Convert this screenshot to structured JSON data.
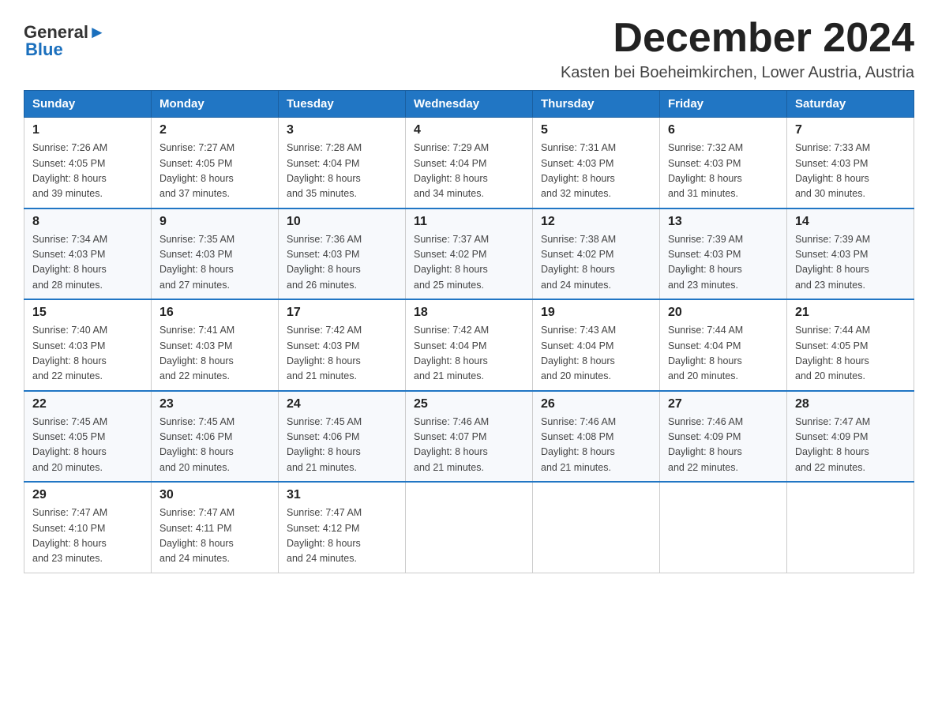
{
  "header": {
    "logo_text_general": "General",
    "logo_text_blue": "Blue",
    "month_title": "December 2024",
    "location": "Kasten bei Boeheimkirchen, Lower Austria, Austria"
  },
  "days_of_week": [
    "Sunday",
    "Monday",
    "Tuesday",
    "Wednesday",
    "Thursday",
    "Friday",
    "Saturday"
  ],
  "weeks": [
    [
      {
        "day": "1",
        "sunrise": "7:26 AM",
        "sunset": "4:05 PM",
        "daylight": "8 hours and 39 minutes."
      },
      {
        "day": "2",
        "sunrise": "7:27 AM",
        "sunset": "4:05 PM",
        "daylight": "8 hours and 37 minutes."
      },
      {
        "day": "3",
        "sunrise": "7:28 AM",
        "sunset": "4:04 PM",
        "daylight": "8 hours and 35 minutes."
      },
      {
        "day": "4",
        "sunrise": "7:29 AM",
        "sunset": "4:04 PM",
        "daylight": "8 hours and 34 minutes."
      },
      {
        "day": "5",
        "sunrise": "7:31 AM",
        "sunset": "4:03 PM",
        "daylight": "8 hours and 32 minutes."
      },
      {
        "day": "6",
        "sunrise": "7:32 AM",
        "sunset": "4:03 PM",
        "daylight": "8 hours and 31 minutes."
      },
      {
        "day": "7",
        "sunrise": "7:33 AM",
        "sunset": "4:03 PM",
        "daylight": "8 hours and 30 minutes."
      }
    ],
    [
      {
        "day": "8",
        "sunrise": "7:34 AM",
        "sunset": "4:03 PM",
        "daylight": "8 hours and 28 minutes."
      },
      {
        "day": "9",
        "sunrise": "7:35 AM",
        "sunset": "4:03 PM",
        "daylight": "8 hours and 27 minutes."
      },
      {
        "day": "10",
        "sunrise": "7:36 AM",
        "sunset": "4:03 PM",
        "daylight": "8 hours and 26 minutes."
      },
      {
        "day": "11",
        "sunrise": "7:37 AM",
        "sunset": "4:02 PM",
        "daylight": "8 hours and 25 minutes."
      },
      {
        "day": "12",
        "sunrise": "7:38 AM",
        "sunset": "4:02 PM",
        "daylight": "8 hours and 24 minutes."
      },
      {
        "day": "13",
        "sunrise": "7:39 AM",
        "sunset": "4:03 PM",
        "daylight": "8 hours and 23 minutes."
      },
      {
        "day": "14",
        "sunrise": "7:39 AM",
        "sunset": "4:03 PM",
        "daylight": "8 hours and 23 minutes."
      }
    ],
    [
      {
        "day": "15",
        "sunrise": "7:40 AM",
        "sunset": "4:03 PM",
        "daylight": "8 hours and 22 minutes."
      },
      {
        "day": "16",
        "sunrise": "7:41 AM",
        "sunset": "4:03 PM",
        "daylight": "8 hours and 22 minutes."
      },
      {
        "day": "17",
        "sunrise": "7:42 AM",
        "sunset": "4:03 PM",
        "daylight": "8 hours and 21 minutes."
      },
      {
        "day": "18",
        "sunrise": "7:42 AM",
        "sunset": "4:04 PM",
        "daylight": "8 hours and 21 minutes."
      },
      {
        "day": "19",
        "sunrise": "7:43 AM",
        "sunset": "4:04 PM",
        "daylight": "8 hours and 20 minutes."
      },
      {
        "day": "20",
        "sunrise": "7:44 AM",
        "sunset": "4:04 PM",
        "daylight": "8 hours and 20 minutes."
      },
      {
        "day": "21",
        "sunrise": "7:44 AM",
        "sunset": "4:05 PM",
        "daylight": "8 hours and 20 minutes."
      }
    ],
    [
      {
        "day": "22",
        "sunrise": "7:45 AM",
        "sunset": "4:05 PM",
        "daylight": "8 hours and 20 minutes."
      },
      {
        "day": "23",
        "sunrise": "7:45 AM",
        "sunset": "4:06 PM",
        "daylight": "8 hours and 20 minutes."
      },
      {
        "day": "24",
        "sunrise": "7:45 AM",
        "sunset": "4:06 PM",
        "daylight": "8 hours and 21 minutes."
      },
      {
        "day": "25",
        "sunrise": "7:46 AM",
        "sunset": "4:07 PM",
        "daylight": "8 hours and 21 minutes."
      },
      {
        "day": "26",
        "sunrise": "7:46 AM",
        "sunset": "4:08 PM",
        "daylight": "8 hours and 21 minutes."
      },
      {
        "day": "27",
        "sunrise": "7:46 AM",
        "sunset": "4:09 PM",
        "daylight": "8 hours and 22 minutes."
      },
      {
        "day": "28",
        "sunrise": "7:47 AM",
        "sunset": "4:09 PM",
        "daylight": "8 hours and 22 minutes."
      }
    ],
    [
      {
        "day": "29",
        "sunrise": "7:47 AM",
        "sunset": "4:10 PM",
        "daylight": "8 hours and 23 minutes."
      },
      {
        "day": "30",
        "sunrise": "7:47 AM",
        "sunset": "4:11 PM",
        "daylight": "8 hours and 24 minutes."
      },
      {
        "day": "31",
        "sunrise": "7:47 AM",
        "sunset": "4:12 PM",
        "daylight": "8 hours and 24 minutes."
      },
      null,
      null,
      null,
      null
    ]
  ],
  "labels": {
    "sunrise": "Sunrise:",
    "sunset": "Sunset:",
    "daylight": "Daylight:"
  }
}
